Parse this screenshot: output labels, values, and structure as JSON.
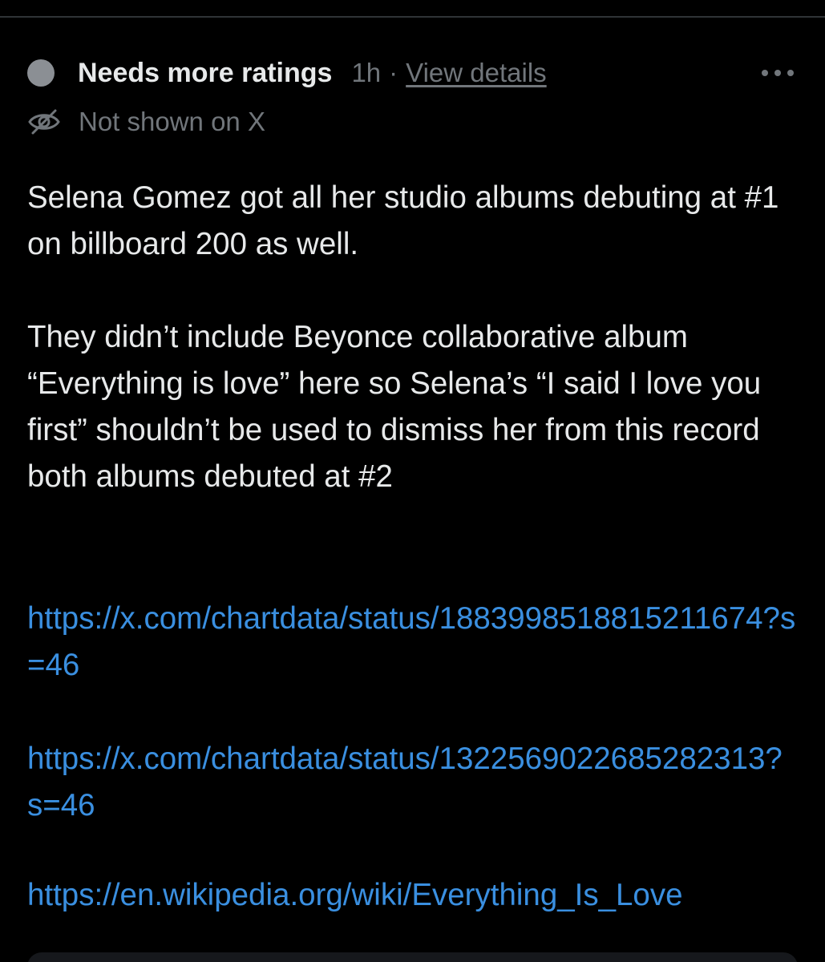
{
  "note": {
    "status": "Needs more ratings",
    "time_ago": "1h",
    "separator": "·",
    "view_details": "View details",
    "more_icon": "more-horizontal-icon",
    "visibility_icon": "eye-off-icon",
    "visibility": "Not shown on X",
    "body": "Selena Gomez got all her studio albums debuting at #1 on billboard 200 as well.\n\nThey didn’t include Beyonce collaborative album “Everything is love” here so Selena’s “I said I love you first” shouldn’t be used to dismiss her from this record both albums debuted at #2",
    "links": [
      "https://x.com/chartdata/status/1883998518815211674?s=46",
      "https://x.com/chartdata/status/1322569022685282313?s=46",
      "https://en.wikipedia.org/wiki/Everything_Is_Love"
    ]
  },
  "colors": {
    "background": "#000000",
    "text": "#e7e9ea",
    "muted": "#71767b",
    "link": "#3a8fe0",
    "status_dot": "#8b8f94"
  }
}
